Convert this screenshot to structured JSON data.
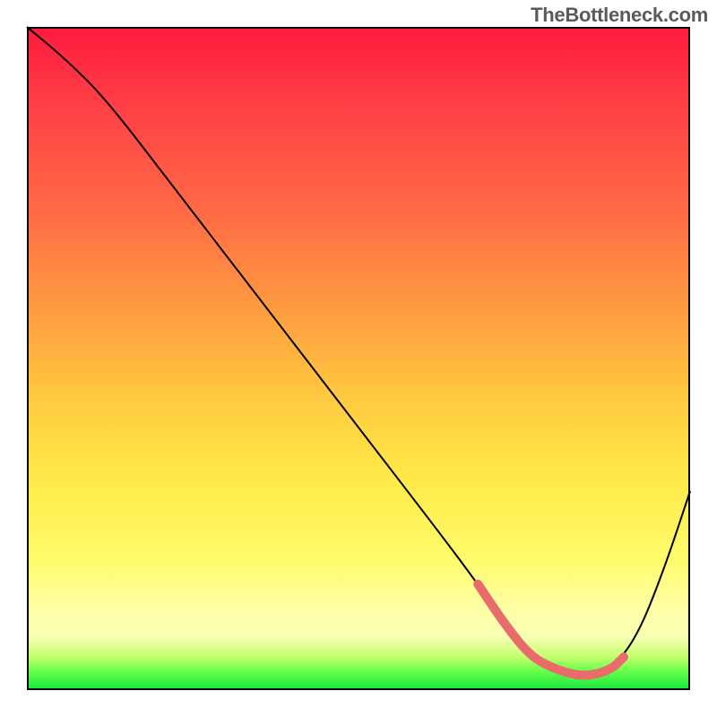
{
  "watermark": "TheBottleneck.com",
  "chart_data": {
    "type": "line",
    "title": "",
    "xlabel": "",
    "ylabel": "",
    "xlim": [
      0,
      100
    ],
    "ylim": [
      0,
      100
    ],
    "grid": false,
    "legend": false,
    "background_gradient": {
      "stops": [
        {
          "pos": 0,
          "color": "#ff1a3f"
        },
        {
          "pos": 10,
          "color": "#ff3a45"
        },
        {
          "pos": 28,
          "color": "#ff6b45"
        },
        {
          "pos": 42,
          "color": "#ff9941"
        },
        {
          "pos": 55,
          "color": "#ffc740"
        },
        {
          "pos": 68,
          "color": "#ffe948"
        },
        {
          "pos": 80,
          "color": "#fffb6a"
        },
        {
          "pos": 88,
          "color": "#ffffa6"
        },
        {
          "pos": 92,
          "color": "#f6ffb2"
        },
        {
          "pos": 95,
          "color": "#c3ff6e"
        },
        {
          "pos": 97,
          "color": "#6bff4a"
        },
        {
          "pos": 100,
          "color": "#13e63e"
        }
      ]
    },
    "series": [
      {
        "name": "main-curve",
        "stroke": "#000000",
        "stroke_width": 2,
        "x": [
          0,
          6,
          12,
          22,
          32,
          42,
          52,
          62,
          68,
          72,
          76,
          80,
          84,
          88,
          92,
          96,
          100
        ],
        "y": [
          100,
          95,
          89,
          76,
          63,
          50,
          37,
          24,
          16,
          10,
          5,
          3,
          2,
          3,
          8,
          18,
          30
        ]
      },
      {
        "name": "highlight-segment",
        "stroke": "#ea6b6b",
        "stroke_width": 10,
        "linecap": "round",
        "x": [
          68,
          72,
          76,
          80,
          84,
          88,
          90
        ],
        "y": [
          16,
          10,
          5,
          3,
          2,
          3,
          5
        ]
      }
    ]
  }
}
